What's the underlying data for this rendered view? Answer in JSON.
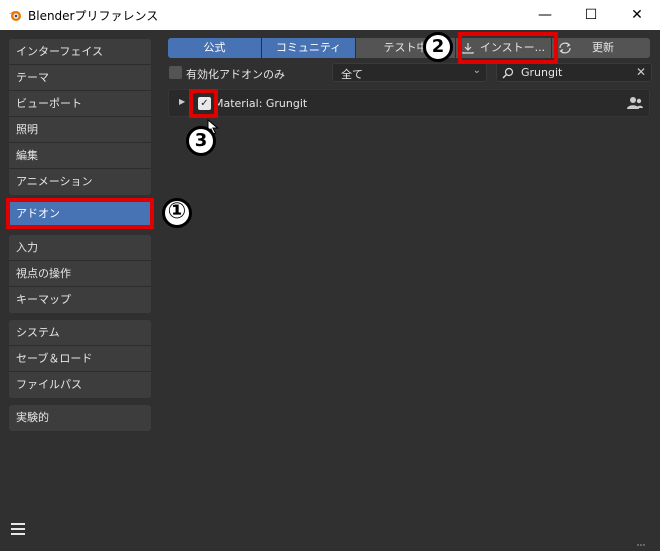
{
  "window": {
    "title": "Blenderプリファレンス",
    "minimize": "—",
    "maximize": "☐",
    "close": "✕"
  },
  "sidebar": {
    "group1": [
      "インターフェイス",
      "テーマ",
      "ビューポート",
      "照明",
      "編集",
      "アニメーション"
    ],
    "active_item": "アドオン",
    "group2": [
      "入力",
      "視点の操作",
      "キーマップ"
    ],
    "group3": [
      "システム",
      "セーブ＆ロード",
      "ファイルパス"
    ],
    "group4": [
      "実験的"
    ]
  },
  "tabs": [
    {
      "label": "公式",
      "active": true
    },
    {
      "label": "コミュニティ",
      "active": true
    },
    {
      "label": "テスト中",
      "active": false
    },
    {
      "label": "インストー...",
      "active": false
    },
    {
      "label": "更新",
      "active": false
    }
  ],
  "filter": {
    "enabled_only_label": "有効化アドオンのみ",
    "category_value": "全て",
    "search_value": "Grungit"
  },
  "addon": {
    "name": "Material: Grungit",
    "enabled": true
  },
  "annotations": {
    "m1": "①",
    "m2": "2",
    "m3": "3"
  },
  "colors": {
    "accent": "#4772b3",
    "highlight_box": "#e00000",
    "background": "#303030"
  }
}
